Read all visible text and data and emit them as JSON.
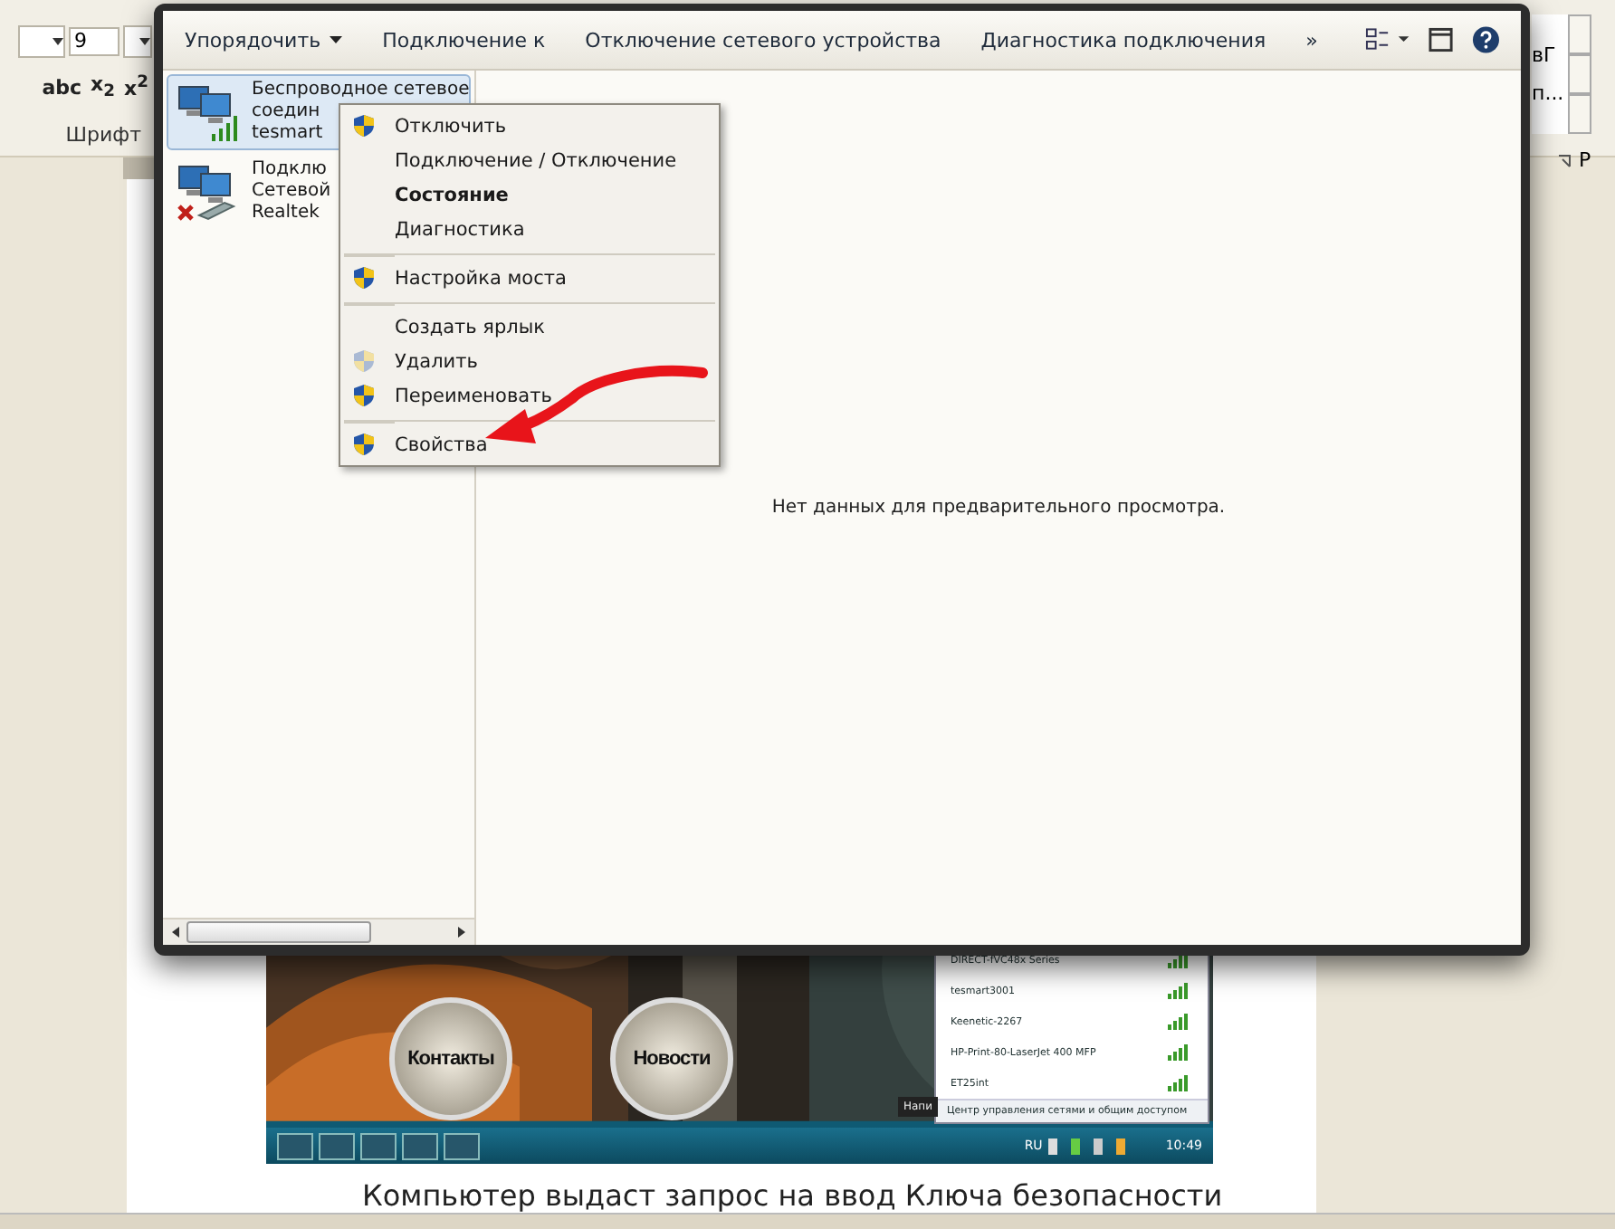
{
  "word": {
    "font_size": "9",
    "format_buttons": [
      "abc",
      "x$_{2}$",
      "x$^{2}$"
    ],
    "font_group_label": "Шрифт",
    "styles_fragments": [
      "вГ",
      "п..."
    ],
    "right_group_label": "Р",
    "document_text": "Компьютер выдаст запрос на ввод Ключа безопасности"
  },
  "explorer": {
    "toolbar": [
      {
        "label": "Упорядочить",
        "dropdown": true
      },
      {
        "label": "Подключение к",
        "dropdown": false
      },
      {
        "label": "Отключение сетевого устройства",
        "dropdown": false
      },
      {
        "label": "Диагностика подключения",
        "dropdown": false
      },
      {
        "label": "»",
        "dropdown": false
      }
    ],
    "connections": [
      {
        "kind": "wireless",
        "selected": true,
        "lines": [
          "Беспроводное сетевое",
          "соедин",
          "tesmart"
        ]
      },
      {
        "kind": "wired-disconnected",
        "selected": false,
        "lines": [
          "Подклю",
          "Сетевой",
          "Realtek"
        ]
      }
    ],
    "context_menu": [
      {
        "label": "Отключить",
        "kind": "shield",
        "bold": false,
        "separator_before": false
      },
      {
        "label": "Подключение / Отключение",
        "kind": "plain",
        "bold": false,
        "separator_before": false
      },
      {
        "label": "Состояние",
        "kind": "plain",
        "bold": true,
        "separator_before": false
      },
      {
        "label": "Диагностика",
        "kind": "plain",
        "bold": false,
        "separator_before": false
      },
      {
        "label": "Настройка моста",
        "kind": "shield",
        "bold": false,
        "separator_before": true
      },
      {
        "label": "Создать ярлык",
        "kind": "plain",
        "bold": false,
        "separator_before": true
      },
      {
        "label": "Удалить",
        "kind": "shield-disabled",
        "bold": false,
        "separator_before": false
      },
      {
        "label": "Переименовать",
        "kind": "shield",
        "bold": false,
        "separator_before": false
      },
      {
        "label": "Свойства",
        "kind": "shield",
        "bold": false,
        "separator_before": true
      }
    ],
    "preview_message": "Нет данных для предварительного просмотра."
  },
  "embedded_screenshot": {
    "buttons": [
      "Контакты",
      "Новости"
    ],
    "networks": [
      "DIRECT-fVC48x Series",
      "tesmart3001",
      "Keenetic-2267",
      "HP-Print-80-LaserJet 400 MFP",
      "ET25int"
    ],
    "network_center_link": "Центр управления сетями и общим доступом",
    "tooltip": "Напи",
    "language": "RU",
    "clock": "10:49"
  }
}
